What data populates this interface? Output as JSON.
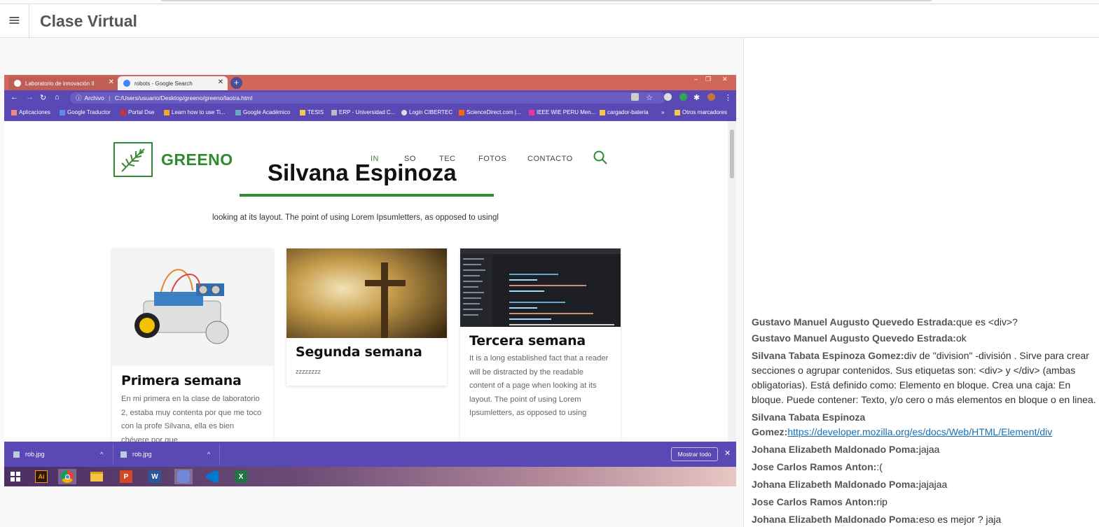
{
  "app": {
    "title": "Clase Virtual",
    "menu_icon": "hamburger-icon"
  },
  "browser": {
    "tabs": [
      {
        "title": "Laboratorio de innovación II"
      },
      {
        "title": "robots - Google Search"
      }
    ],
    "address_prefix": "Archivo",
    "address": "C:/Users/usuario/Desktop/greeno/greeno/laotra.html",
    "bookmarks": [
      "Aplicaciones",
      "Google Traductor",
      "Portal Dse",
      "Learn how to use Ti...",
      "Google Académico",
      "TESIS",
      "ERP - Universidad C...",
      "Login CIBERTEC",
      "ScienceDirect.com |...",
      "IEEE WIE PERU Men...",
      "cargador-bateria",
      "»",
      "Otros marcadores"
    ]
  },
  "site": {
    "logo": "GREENO",
    "menu": [
      "IN",
      "SO",
      "TEC",
      "FOTOS",
      "CONTACTO"
    ],
    "hero_name": "Silvana Espinoza",
    "hero_sub": "looking at its layout. The point of using Lorem Ipsumletters, as opposed to usingl",
    "cards": [
      {
        "title": "Primera semana",
        "text": "En mi primera en la clase de laboratorio 2, estaba muy contenta por que me toco con la profe Silvana, ella es bien chévere por que"
      },
      {
        "title": "Segunda semana",
        "text": "zzzzzzzz"
      },
      {
        "title": "Tercera semana",
        "text": "It is a long established fact that a reader will be distracted by the readable content of a page when looking at its layout. The point of using Lorem Ipsumletters, as opposed to using"
      }
    ]
  },
  "downloads": {
    "items": [
      "rob.jpg",
      "rob.jpg"
    ],
    "show_all": "Mostrar todo"
  },
  "taskbar": {
    "apps": [
      "windows-start-icon",
      "illustrator-icon",
      "chrome-icon",
      "file-explorer-icon",
      "powerpoint-icon",
      "word-icon",
      "discord-icon",
      "vscode-icon",
      "excel-icon"
    ]
  },
  "chat": {
    "messages": [
      {
        "author": "Gustavo Manuel Augusto Quevedo Estrada:",
        "text": "que es <div>?"
      },
      {
        "author": "Gustavo Manuel Augusto Quevedo Estrada:",
        "text": "ok"
      },
      {
        "author": "Silvana Tabata Espinoza Gomez:",
        "text": "div de \"division\" -división . Sirve para crear secciones o agrupar contenidos. Sus etiquetas son: <div> y </div> (ambas obligatorias). Está definido como: Elemento en bloque. Crea una caja: En bloque. Puede contener: Texto, y/o cero o más elementos en bloque o en linea."
      },
      {
        "author": "Silvana Tabata Espinoza Gomez:",
        "link": "https://developer.mozilla.org/es/docs/Web/HTML/Element/div"
      },
      {
        "author": "Johana Elizabeth Maldonado Poma:",
        "text": "jajaa"
      },
      {
        "author": "Jose Carlos Ramos Anton:",
        "text": ":("
      },
      {
        "author": "Johana Elizabeth Maldonado Poma:",
        "text": "jajajaa"
      },
      {
        "author": "Jose Carlos Ramos Anton:",
        "text": "rip"
      },
      {
        "author": "Johana Elizabeth Maldonado Poma:",
        "text": "eso es mejor ? jaja"
      }
    ]
  }
}
